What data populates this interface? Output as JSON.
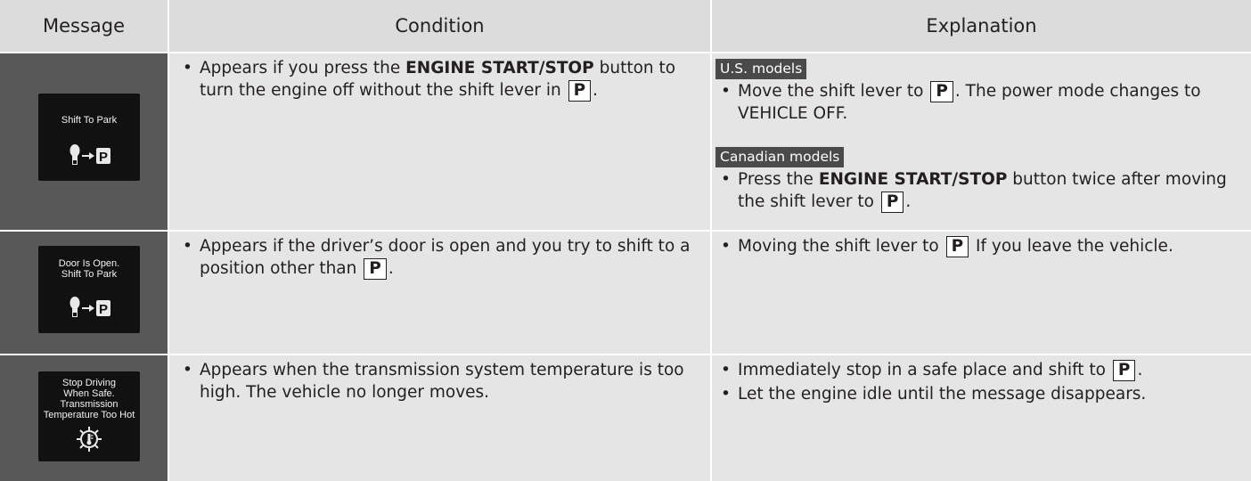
{
  "header": {
    "message": "Message",
    "condition": "Condition",
    "explanation": "Explanation"
  },
  "rows": [
    {
      "screen": [
        "Shift To Park"
      ],
      "condition": {
        "pre": "Appears if you press the ",
        "bold": "ENGINE START/STOP",
        "mid": " button to turn the engine off without the shift lever in ",
        "p": "P",
        "post": "."
      },
      "explanation": {
        "us_tag": "U.S. models",
        "us_pre": "Move the shift lever to ",
        "us_p": "P",
        "us_post": ". The power mode changes to VEHICLE OFF.",
        "ca_tag": "Canadian models",
        "ca_pre": "Press the ",
        "ca_bold": "ENGINE START/STOP",
        "ca_mid": " button twice after moving the shift lever to ",
        "ca_p": "P",
        "ca_post": "."
      }
    },
    {
      "screen": [
        "Door Is Open.",
        "Shift To Park"
      ],
      "condition": {
        "pre": "Appears if the driver’s door is open and you try to shift to a position other than ",
        "p": "P",
        "post": "."
      },
      "explanation": {
        "pre": "Moving the shift lever to ",
        "p": "P",
        "post": " If you leave the vehicle."
      }
    },
    {
      "screen": [
        "Stop Driving",
        "When Safe.",
        "Transmission",
        "Temperature Too Hot"
      ],
      "condition": {
        "text": "Appears when the transmission system temperature is too high. The vehicle no longer moves."
      },
      "explanation": {
        "b1_pre": "Immediately stop in a safe place and shift to ",
        "b1_p": "P",
        "b1_post": ".",
        "b2": "Let the engine idle until the message disappears."
      }
    }
  ],
  "bullet": "•",
  "icons": {
    "row1": "shift-to-park-icon",
    "row2": "shift-to-park-icon",
    "row3": "transmission-temperature-icon"
  }
}
